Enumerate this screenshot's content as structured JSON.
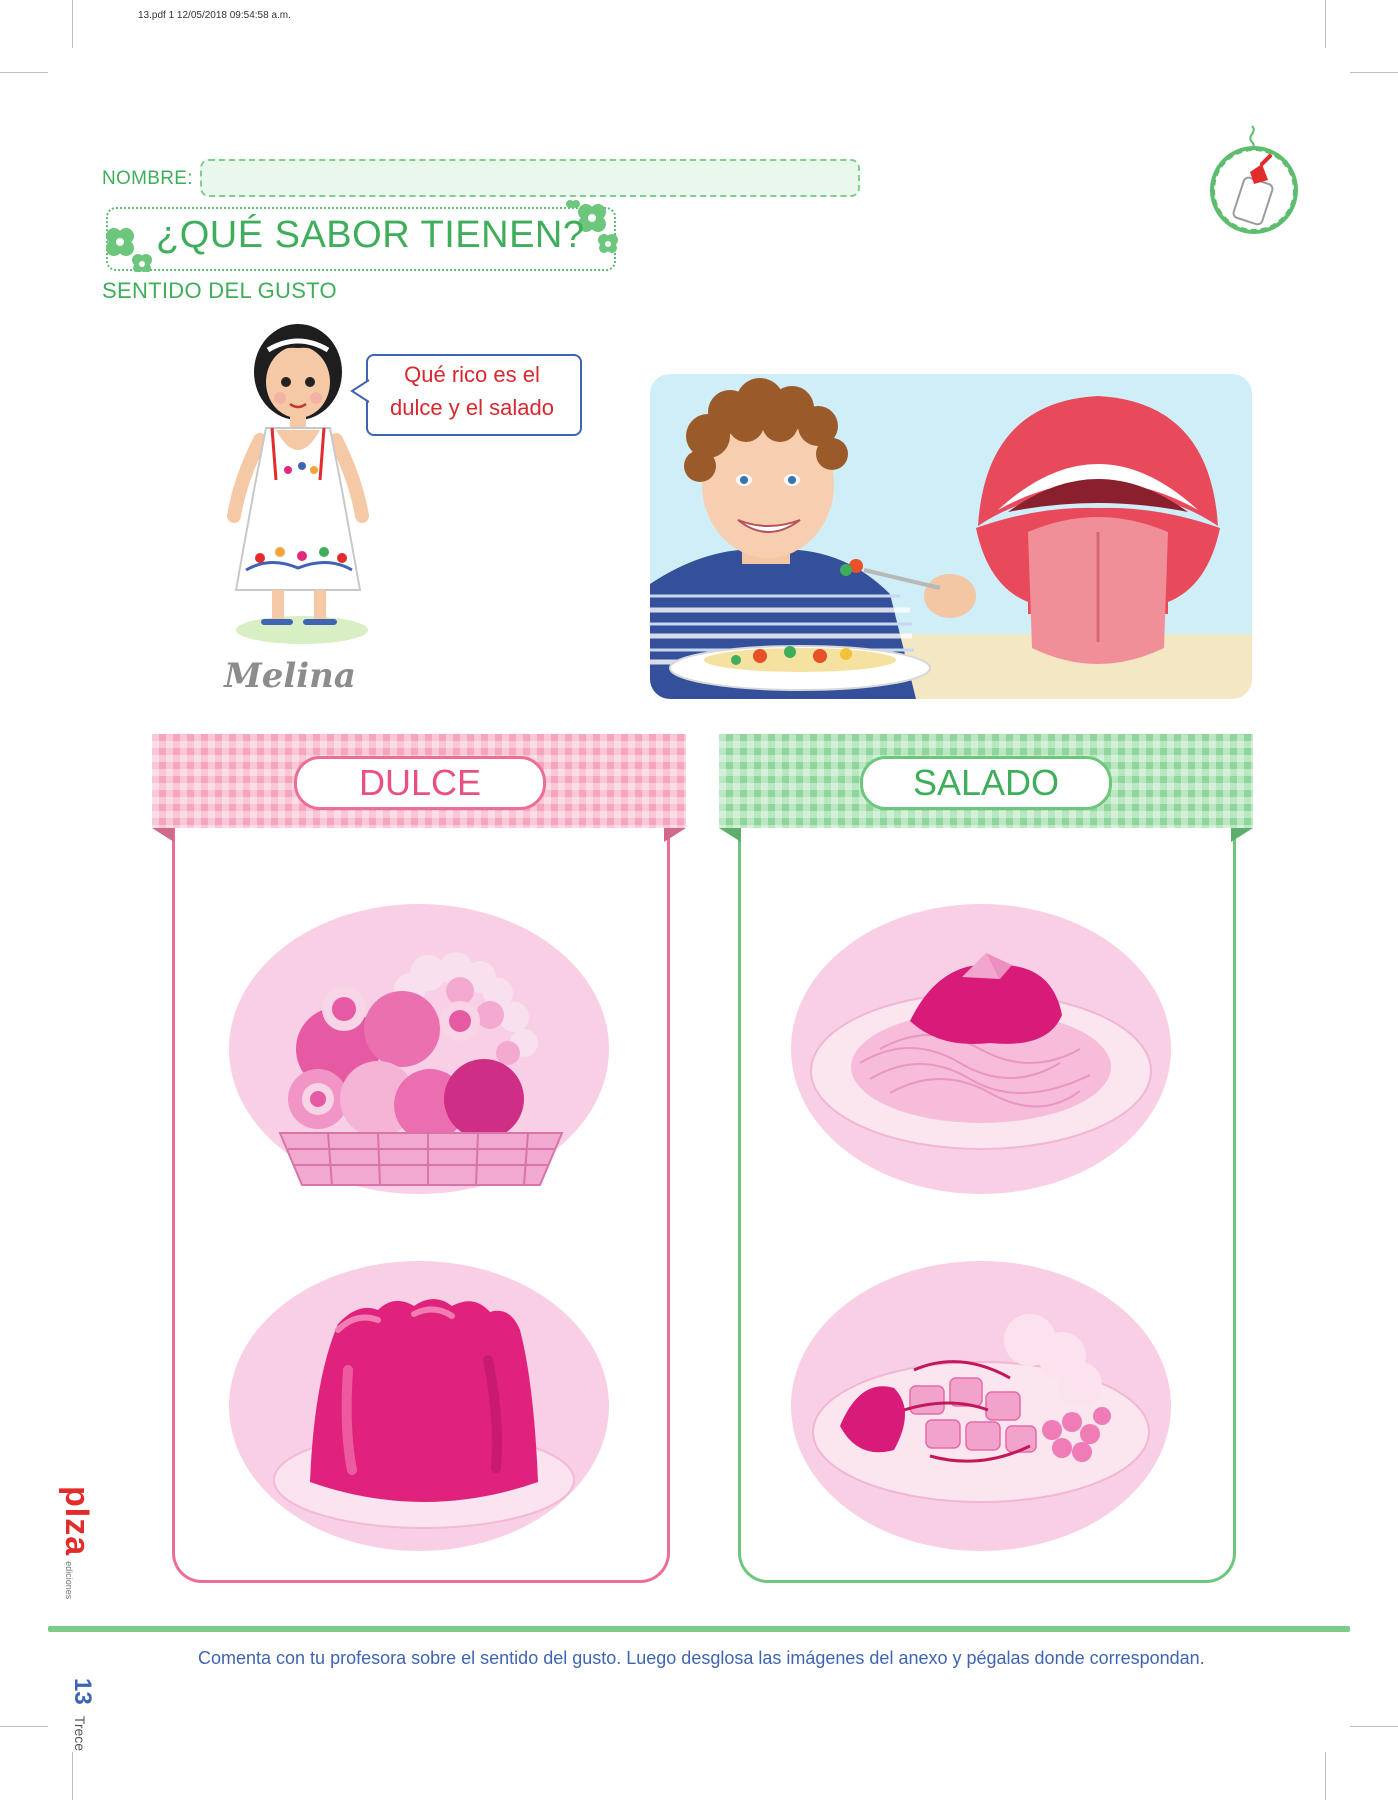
{
  "print_info": "13.pdf  1  12/05/2018  09:54:58 a.m.",
  "worksheet": {
    "name_label": "NOMBRE:",
    "title": "¿QUÉ SABOR TIENEN?",
    "subtitle": "SENTIDO DEL GUSTO"
  },
  "character": {
    "name": "Melina",
    "speech_line1": "Qué rico es el",
    "speech_line2": "dulce y el salado"
  },
  "categories": {
    "sweet_label": "DULCE",
    "salty_label": "SALADO"
  },
  "footer": {
    "instructions": "Comenta con tu profesora sobre el sentido del gusto. Luego desglosa las imágenes del anexo y pégalas donde correspondan.",
    "page_number": "13",
    "page_word": "Trece",
    "brand": "pIza",
    "brand_sub": "ediciones"
  },
  "colors": {
    "green": "#3fae5a",
    "pink": "#ec6e93",
    "magenta": "#e0227c",
    "blue": "#3f64b4",
    "red": "#d8282e"
  },
  "icons": {
    "glue": "glue-bottle-icon",
    "flower": "flower-icon"
  }
}
